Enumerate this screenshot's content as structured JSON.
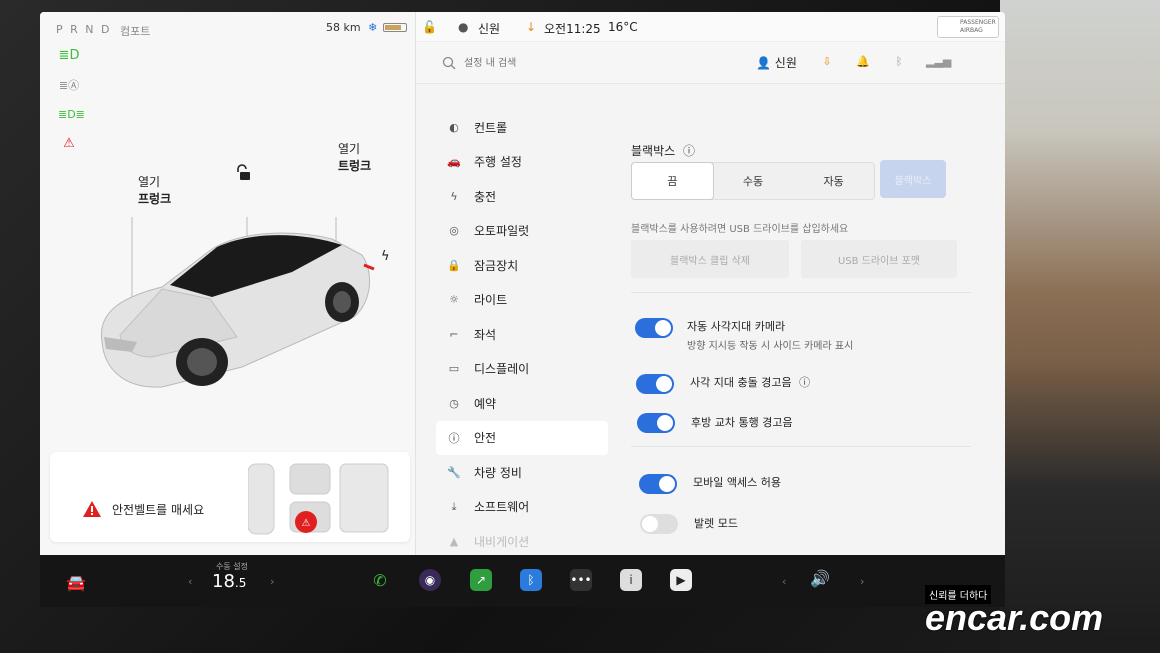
{
  "status": {
    "gear": "P R N D",
    "drive_mode": "컴포트",
    "range": "58 km",
    "user": "신원",
    "time": "오전11:25",
    "temp": "16°C",
    "airbag": "PASSENGER AIRBAG"
  },
  "car": {
    "frunk_label_1": "열기",
    "frunk_label_2": "프렁크",
    "trunk_label_1": "열기",
    "trunk_label_2": "트렁크",
    "seatbelt_warning": "안전벨트를 매세요"
  },
  "search": {
    "placeholder": "설정 내 검색"
  },
  "profile": {
    "name": "신원"
  },
  "menu": [
    {
      "label": "컨트롤",
      "icon": "toggle-icon"
    },
    {
      "label": "주행 설정",
      "icon": "car-icon"
    },
    {
      "label": "충전",
      "icon": "bolt-icon"
    },
    {
      "label": "오토파일럿",
      "icon": "steering-wheel-icon"
    },
    {
      "label": "잠금장치",
      "icon": "lock-icon"
    },
    {
      "label": "라이트",
      "icon": "sun-icon"
    },
    {
      "label": "좌석",
      "icon": "seat-icon"
    },
    {
      "label": "디스플레이",
      "icon": "display-icon"
    },
    {
      "label": "예약",
      "icon": "clock-icon"
    },
    {
      "label": "안전",
      "icon": "info-circle-icon",
      "active": true
    },
    {
      "label": "차량 정비",
      "icon": "wrench-icon"
    },
    {
      "label": "소프트웨어",
      "icon": "download-icon"
    },
    {
      "label": "내비게이션",
      "icon": "nav-arrow-icon"
    }
  ],
  "safety": {
    "dashcam_title": "블랙박스",
    "dashcam_options": [
      "끔",
      "수동",
      "자동"
    ],
    "dashcam_selected": "끔",
    "format_button": "블랙박스",
    "usb_hint": "블랙박스를 사용하려면 USB 드라이브를 삽입하세요",
    "delete_clips": "블랙박스 클립 삭제",
    "format_usb": "USB 드라이브 포맷",
    "options": [
      {
        "label": "자동 사각지대 카메라",
        "sub": "방향 지시등 작동 시 사이드 카메라 표시",
        "on": true
      },
      {
        "label": "사각 지대 충돌 경고음",
        "on": true
      },
      {
        "label": "후방 교차 통행 경고음",
        "on": true
      },
      {
        "label": "모바일 액세스 허용",
        "on": true
      },
      {
        "label": "발렛 모드",
        "on": false
      }
    ]
  },
  "taskbar": {
    "climate_label": "수동 설정",
    "climate_temp": "18",
    "climate_decimal": ".5"
  },
  "watermark": {
    "small": "신뢰를 더하다",
    "big": "encar.com"
  },
  "colors": {
    "accent": "#2a6fdb",
    "warning": "#e02020",
    "green": "#3bbf3b"
  }
}
